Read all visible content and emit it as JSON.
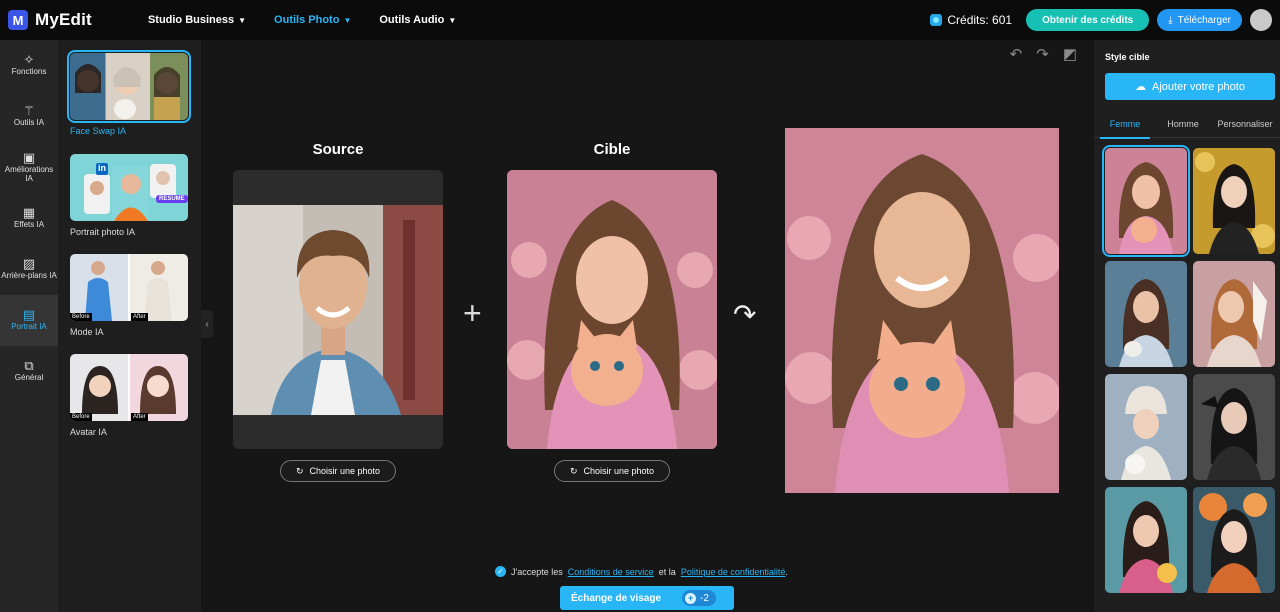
{
  "app": {
    "name": "MyEdit",
    "logo_letter": "M"
  },
  "topnav": [
    {
      "label": "Studio Business",
      "active": false
    },
    {
      "label": "Outils Photo",
      "active": true
    },
    {
      "label": "Outils Audio",
      "active": false
    }
  ],
  "header": {
    "credits_label": "Crédits: 601",
    "get_credits": "Obtenir des crédits",
    "download": "Télécharger"
  },
  "rail": [
    {
      "label": "Fonctions",
      "icon": "sparkle-icon"
    },
    {
      "label": "Outils IA",
      "icon": "magic-wand-icon"
    },
    {
      "label": "Améliorations IA",
      "icon": "enhance-icon"
    },
    {
      "label": "Effets IA",
      "icon": "effects-icon"
    },
    {
      "label": "Arrière-plans IA",
      "icon": "background-icon"
    },
    {
      "label": "Portrait IA",
      "icon": "portrait-icon",
      "active": true
    },
    {
      "label": "Général",
      "icon": "general-icon"
    }
  ],
  "tools": [
    {
      "label": "Face Swap IA",
      "active": true
    },
    {
      "label": "Portrait photo IA",
      "badge": "RESUME",
      "in": "in"
    },
    {
      "label": "Mode IA",
      "before": "Before",
      "after": "After"
    },
    {
      "label": "Avatar IA",
      "before": "Before",
      "after": "After"
    }
  ],
  "canvas": {
    "source_title": "Source",
    "target_title": "Cible",
    "choose_photo": "Choisir une photo",
    "terms_prefix": "J'accepte les",
    "terms_link": "Conditions de service",
    "terms_mid": "et la",
    "privacy_link": "Politique de confidentialité",
    "terms_suffix": ".",
    "swap_button": "Échange de visage",
    "swap_cost": "-2"
  },
  "right": {
    "title": "Style cible",
    "add_photo": "Ajouter votre photo",
    "tabs": [
      "Femme",
      "Homme",
      "Personnaliser"
    ],
    "active_tab": 0
  },
  "colors": {
    "accent": "#29b6f6",
    "teal": "#16c1b4",
    "brand": "#3b55e6"
  }
}
